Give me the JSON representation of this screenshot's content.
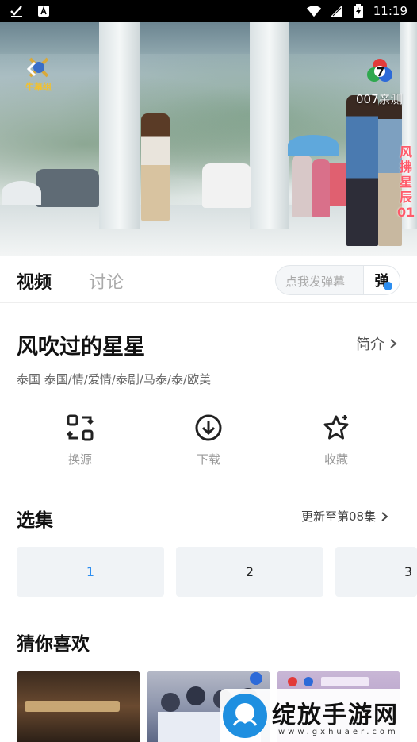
{
  "status_bar": {
    "time": "11:19"
  },
  "video": {
    "channel_logo_text": "牛幕组",
    "channel_name": "007亲测",
    "overlay_title": "风拂星辰01"
  },
  "tabs": [
    {
      "label": "视频"
    },
    {
      "label": "讨论"
    }
  ],
  "danmu": {
    "placeholder": "点我发弹幕",
    "button_label": "弹"
  },
  "show": {
    "title": "风吹过的星星",
    "intro_label": "简介",
    "tags": "泰国  泰国/情/爱情/泰剧/马泰/泰/欧美"
  },
  "actions": [
    {
      "label": "换源",
      "icon": "switch-source-icon"
    },
    {
      "label": "下载",
      "icon": "download-icon"
    },
    {
      "label": "收藏",
      "icon": "favorite-star-icon"
    }
  ],
  "episodes": {
    "section_title": "选集",
    "update_text": "更新至第08集",
    "items": [
      "1",
      "2",
      "3"
    ],
    "selected": "1"
  },
  "recommend": {
    "section_title": "猜你喜欢"
  },
  "watermark": {
    "text": "绽放手游网",
    "sub": "www.gxhuaer.com"
  },
  "colors": {
    "accent": "#2d8ef0",
    "tab_inactive": "#aaaaaa",
    "episode_bg": "#f0f3f6"
  }
}
